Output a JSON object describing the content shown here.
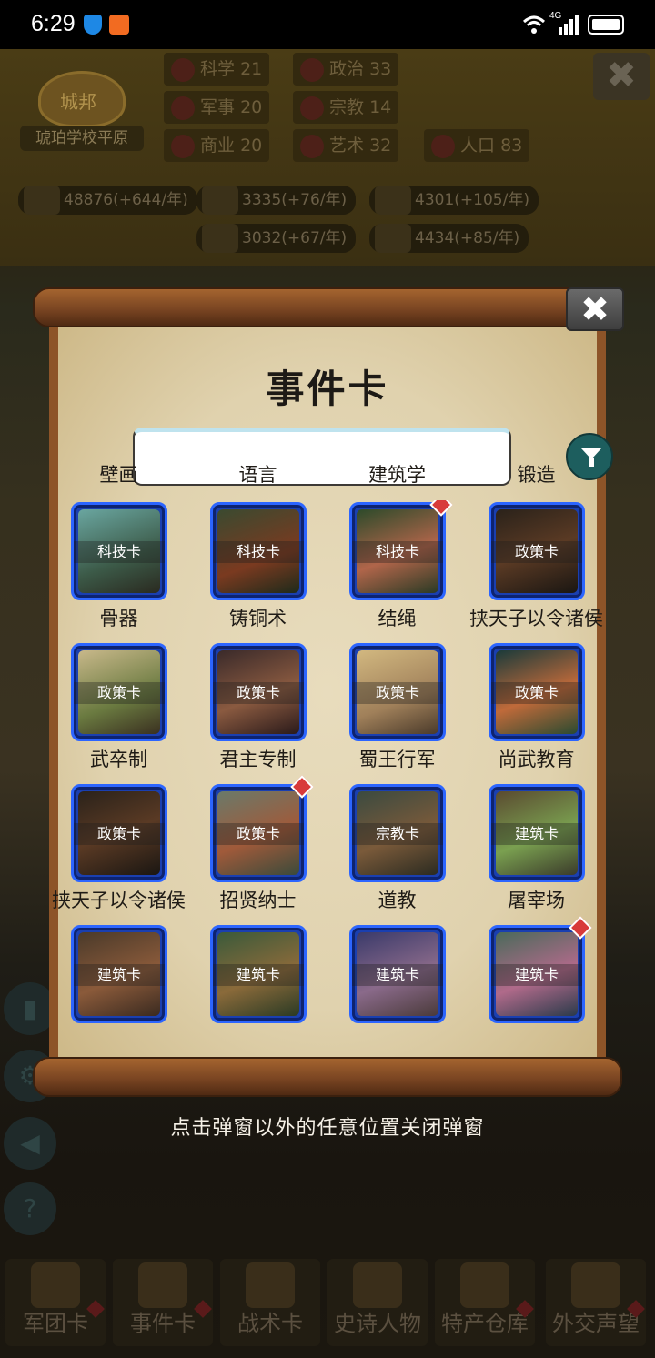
{
  "status_bar": {
    "time": "6:29",
    "network": "4G"
  },
  "header": {
    "crest_label": "城邦",
    "city_name": "琥珀学校平原",
    "stats": [
      {
        "label": "科学",
        "value": "21"
      },
      {
        "label": "政治",
        "value": "33"
      },
      {
        "label": "军事",
        "value": "20"
      },
      {
        "label": "宗教",
        "value": "14"
      },
      {
        "label": "商业",
        "value": "20"
      },
      {
        "label": "艺术",
        "value": "32"
      },
      {
        "label": "人口",
        "value": "83"
      }
    ],
    "resources": [
      "48876(+644/年)",
      "3335(+76/年)",
      "4301(+105/年)",
      "3032(+67/年)",
      "4434(+85/年)"
    ]
  },
  "popup": {
    "title": "事件卡",
    "close_symbol": "✖",
    "search": {
      "value": "",
      "placeholder": ""
    },
    "top_labels": [
      "壁画",
      "语言",
      "建筑学",
      "锻造"
    ],
    "cards": [
      {
        "type": "科技卡",
        "name": "骨器",
        "badge": false
      },
      {
        "type": "科技卡",
        "name": "铸铜术",
        "badge": false
      },
      {
        "type": "科技卡",
        "name": "结绳",
        "badge": true
      },
      {
        "type": "政策卡",
        "name": "挟天子以令诸侯",
        "badge": false
      },
      {
        "type": "政策卡",
        "name": "武卒制",
        "badge": false
      },
      {
        "type": "政策卡",
        "name": "君主专制",
        "badge": false
      },
      {
        "type": "政策卡",
        "name": "蜀王行军",
        "badge": false
      },
      {
        "type": "政策卡",
        "name": "尚武教育",
        "badge": false
      },
      {
        "type": "政策卡",
        "name": "挟天子以令诸侯",
        "badge": false
      },
      {
        "type": "政策卡",
        "name": "招贤纳士",
        "badge": true
      },
      {
        "type": "宗教卡",
        "name": "道教",
        "badge": false
      },
      {
        "type": "建筑卡",
        "name": "屠宰场",
        "badge": false
      },
      {
        "type": "建筑卡",
        "name": "",
        "badge": false
      },
      {
        "type": "建筑卡",
        "name": "",
        "badge": false
      },
      {
        "type": "建筑卡",
        "name": "",
        "badge": false
      },
      {
        "type": "建筑卡",
        "name": "",
        "badge": true
      }
    ]
  },
  "hint": "点击弹窗以外的任意位置关闭弹窗",
  "bottom_nav": [
    "军团卡",
    "事件卡",
    "战术卡",
    "史诗人物",
    "特产仓库",
    "外交声望"
  ],
  "colors": {
    "card_border": "#2c65ff",
    "badge": "#d83a3a",
    "filter_button": "#1d5e5e",
    "scroll_wood": "#8d5428"
  }
}
